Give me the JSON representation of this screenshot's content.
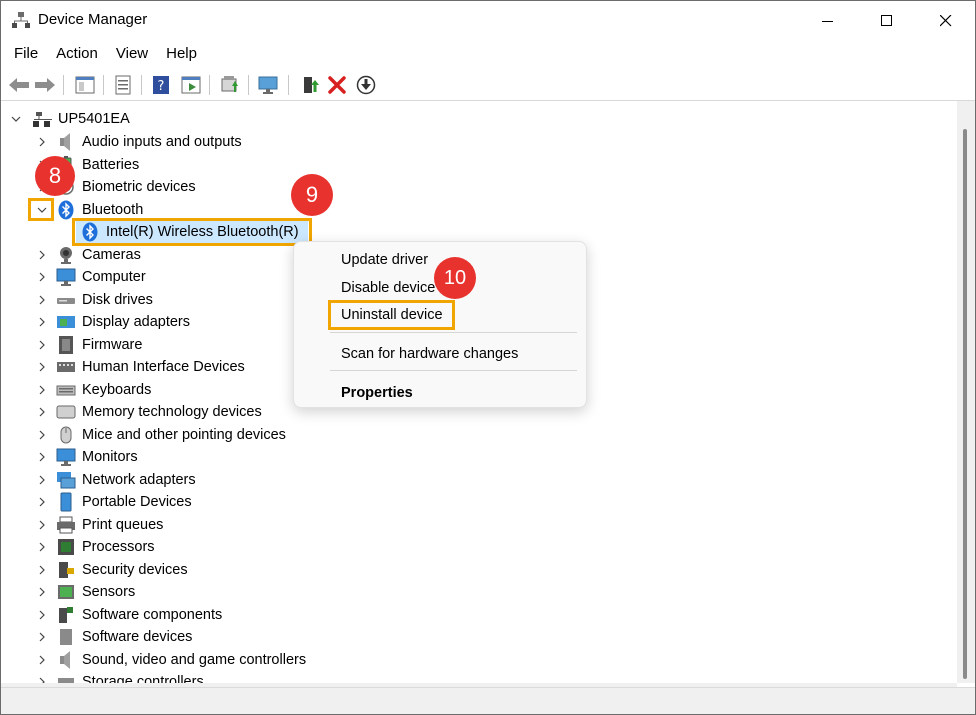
{
  "window": {
    "title": "Device Manager"
  },
  "menu": [
    "File",
    "Action",
    "View",
    "Help"
  ],
  "tree": {
    "root": "UP5401EA",
    "categories": [
      "Audio inputs and outputs",
      "Batteries",
      "Biometric devices",
      "Bluetooth",
      "Cameras",
      "Computer",
      "Disk drives",
      "Display adapters",
      "Firmware",
      "Human Interface Devices",
      "Keyboards",
      "Memory technology devices",
      "Mice and other pointing devices",
      "Monitors",
      "Network adapters",
      "Portable Devices",
      "Print queues",
      "Processors",
      "Security devices",
      "Sensors",
      "Software components",
      "Software devices",
      "Sound, video and game controllers",
      "Storage controllers"
    ],
    "bluetooth_child": "Intel(R) Wireless Bluetooth(R)"
  },
  "context_menu": {
    "update": "Update driver",
    "disable": "Disable device",
    "uninstall": "Uninstall device",
    "scan": "Scan for hardware changes",
    "properties": "Properties"
  },
  "steps": {
    "s8": "8",
    "s9": "9",
    "s10": "10"
  },
  "colors": {
    "highlight": "#f0a500",
    "badge": "#e8322e",
    "selection": "#cce8ff"
  }
}
